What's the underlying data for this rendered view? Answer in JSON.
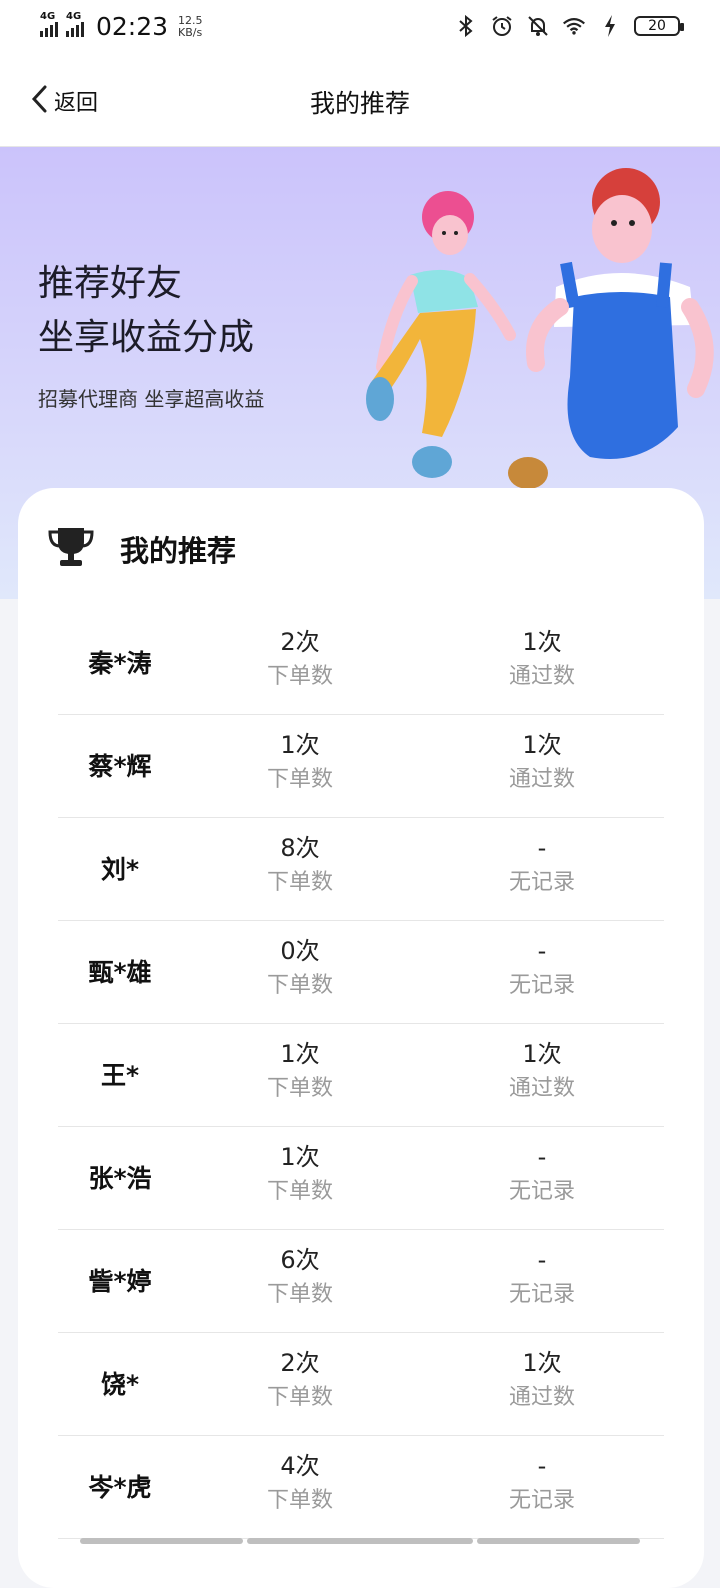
{
  "status_bar": {
    "network1": "4G",
    "network2": "4G",
    "time": "02:23",
    "speed_value": "12.5",
    "speed_unit": "KB/s",
    "battery": "20",
    "icons": [
      "bluetooth-icon",
      "alarm-icon",
      "mute-bell-icon",
      "wifi-icon",
      "charging-icon",
      "battery-icon"
    ]
  },
  "nav": {
    "back_label": "返回",
    "title": "我的推荐"
  },
  "banner": {
    "headline_line1": "推荐好友",
    "headline_line2": "坐享收益分成",
    "subtitle": "招募代理商 坐享超高收益"
  },
  "card": {
    "title": "我的推荐",
    "rows": [
      {
        "name": "秦*涛",
        "orders": "2次",
        "orders_label": "下单数",
        "passed": "1次",
        "passed_label": "通过数"
      },
      {
        "name": "蔡*辉",
        "orders": "1次",
        "orders_label": "下单数",
        "passed": "1次",
        "passed_label": "通过数"
      },
      {
        "name": "刘*",
        "orders": "8次",
        "orders_label": "下单数",
        "passed": "-",
        "passed_label": "无记录"
      },
      {
        "name": "甄*雄",
        "orders": "0次",
        "orders_label": "下单数",
        "passed": "-",
        "passed_label": "无记录"
      },
      {
        "name": "王*",
        "orders": "1次",
        "orders_label": "下单数",
        "passed": "1次",
        "passed_label": "通过数"
      },
      {
        "name": "张*浩",
        "orders": "1次",
        "orders_label": "下单数",
        "passed": "-",
        "passed_label": "无记录"
      },
      {
        "name": "訾*婷",
        "orders": "6次",
        "orders_label": "下单数",
        "passed": "-",
        "passed_label": "无记录"
      },
      {
        "name": "饶*",
        "orders": "2次",
        "orders_label": "下单数",
        "passed": "1次",
        "passed_label": "通过数"
      },
      {
        "name": "岑*虎",
        "orders": "4次",
        "orders_label": "下单数",
        "passed": "-",
        "passed_label": "无记录"
      }
    ]
  },
  "colors": {
    "banner_top": "#cbc3fb",
    "banner_bottom": "#e0e8fb",
    "muted_text": "#9a9a9a"
  }
}
